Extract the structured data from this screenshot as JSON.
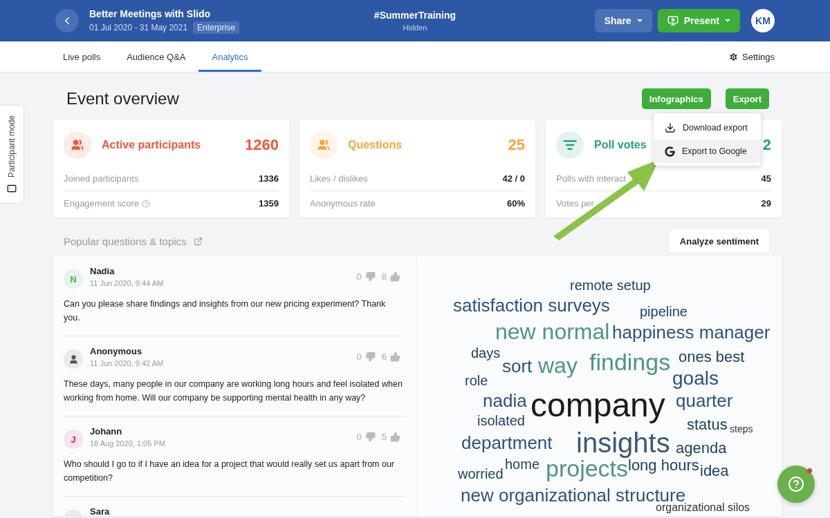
{
  "header": {
    "event_title": "Better Meetings with Slido",
    "dates": "01 Jul 2020 - 31 May 2021",
    "plan_badge": "Enterprise",
    "event_code": "#SummerTraining",
    "visibility": "Hidden",
    "share_button": "Share",
    "present_button": "Present",
    "avatar_initials": "KM"
  },
  "tabs": [
    {
      "label": "Live polls",
      "selected": false
    },
    {
      "label": "Audience Q&A",
      "selected": false
    },
    {
      "label": "Analytics",
      "selected": true
    }
  ],
  "settings_link": "Settings",
  "side_tab": "Participant mode",
  "page_title": "Event overview",
  "actions": {
    "infographics_button": "Infographics",
    "export_button": "Export"
  },
  "export_menu": [
    {
      "kind": "download",
      "label": "Download export",
      "selected": false
    },
    {
      "kind": "google",
      "label": "Export to Google",
      "selected": true
    }
  ],
  "stat_cards": [
    {
      "kind": "people",
      "title": "Active participants",
      "value": "1260",
      "color": "#f0573a",
      "rows": [
        {
          "label": "Joined participants",
          "value": "1336",
          "info": false
        },
        {
          "label": "Engagement score",
          "value": "1359",
          "info": true
        }
      ]
    },
    {
      "kind": "people",
      "title": "Questions",
      "value": "25",
      "color": "#f5a63a",
      "rows": [
        {
          "label": "Likes / dislikes",
          "value": "42 / 0",
          "info": false
        },
        {
          "label": "Anonymous rate",
          "value": "60%",
          "info": false
        }
      ]
    },
    {
      "kind": "poll",
      "title": "Poll votes",
      "value": "2",
      "color": "#23a084",
      "rows": [
        {
          "label": "Polls with interact",
          "value": "45",
          "info": false
        },
        {
          "label": "Votes per",
          "value": "29",
          "info": false
        }
      ]
    }
  ],
  "popular_heading": "Popular questions & topics",
  "analyze_button": "Analyze sentiment",
  "questions": [
    {
      "kind": "initial",
      "initial": "N",
      "color": "#4caf50",
      "name": "Nadia",
      "time": "11 Jun 2020, 9:44 AM",
      "dislikes": "0",
      "likes": "8",
      "text": "Can you please share findings and insights from our new pricing experiment? Thank you."
    },
    {
      "kind": "anonymous",
      "color": "#555555",
      "name": "Anonymous",
      "time": "11 Jun 2020, 9:42 AM",
      "dislikes": "0",
      "likes": "6",
      "text": "These days, many people in our company are working long hours and feel isolated when working from home. Will our company be supporting mental health in any way?"
    },
    {
      "kind": "initial",
      "initial": "J",
      "color": "#d81b60",
      "name": "Johann",
      "time": "18 Aug 2020, 1:05 PM",
      "dislikes": "0",
      "likes": "5",
      "text": "Who should I go to if I have an idea for a project that would really set us apart from our competition?"
    },
    {
      "kind": "plain",
      "name": "Sara"
    }
  ],
  "word_cloud": [
    {
      "word": "remote setup",
      "color": "#1f3f66"
    },
    {
      "word": "satisfaction surveys",
      "color": "#2c5282"
    },
    {
      "word": "pipeline",
      "color": "#1f3f66"
    },
    {
      "word": "new normal",
      "color": "#4f9488"
    },
    {
      "word": "happiness manager",
      "color": "#2c5282"
    },
    {
      "word": "days",
      "color": "#1f3f66"
    },
    {
      "word": "sort",
      "color": "#2c5282"
    },
    {
      "word": "way",
      "color": "#4f9488"
    },
    {
      "word": "findings",
      "color": "#4f9488"
    },
    {
      "word": "ones best",
      "color": "#1f3f66"
    },
    {
      "word": "role",
      "color": "#1f3f66"
    },
    {
      "word": "goals",
      "color": "#2c5282"
    },
    {
      "word": "nadia",
      "color": "#2c5282"
    },
    {
      "word": "company",
      "color": "#1b1b1b"
    },
    {
      "word": "quarter",
      "color": "#2c5282"
    },
    {
      "word": "isolated",
      "color": "#1f3f66"
    },
    {
      "word": "status",
      "color": "#1f3f66"
    },
    {
      "word": "steps",
      "color": "#333333"
    },
    {
      "word": "department",
      "color": "#2c5282"
    },
    {
      "word": "insights",
      "color": "#3d5878"
    },
    {
      "word": "agenda",
      "color": "#1f3f66"
    },
    {
      "word": "worried",
      "color": "#1f3f66"
    },
    {
      "word": "home",
      "color": "#1f3f66"
    },
    {
      "word": "projects",
      "color": "#4f9488"
    },
    {
      "word": "long hours",
      "color": "#1f3f66"
    },
    {
      "word": "idea",
      "color": "#1f3f66"
    },
    {
      "word": "new organizational structure",
      "color": "#2c5282"
    },
    {
      "word": "organizational silos",
      "color": "#333333"
    }
  ]
}
